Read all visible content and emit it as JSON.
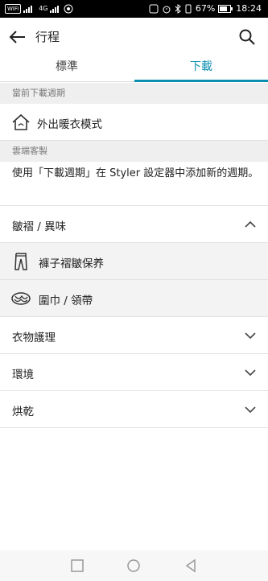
{
  "status_bar": {
    "left_chip": "WiFi",
    "network": "4G",
    "battery": "67%",
    "time": "18:24"
  },
  "app_bar": {
    "title": "行程"
  },
  "tabs": [
    {
      "label": "標準",
      "selected": false
    },
    {
      "label": "下載",
      "selected": true
    }
  ],
  "sections": {
    "current_cycle_header": "當前下載週期",
    "current_cycle_item": "外出暖衣模式",
    "cloud_header": "雲端客製",
    "cloud_description": "使用「下載週期」在 Styler 設定器中添加新的週期。"
  },
  "categories": [
    {
      "label": "皺褶 / 異味",
      "expanded": true
    },
    {
      "label": "衣物護理",
      "expanded": false
    },
    {
      "label": "環境",
      "expanded": false
    },
    {
      "label": "烘乾",
      "expanded": false
    }
  ],
  "subitems": [
    {
      "label": "褲子褶皺保养",
      "icon": "pants-icon"
    },
    {
      "label": "圍巾 / 領帶",
      "icon": "scarf-icon"
    }
  ],
  "colors": {
    "accent": "#0b8fb0",
    "section_bg": "#efefef",
    "divider": "#e2e2e2"
  }
}
